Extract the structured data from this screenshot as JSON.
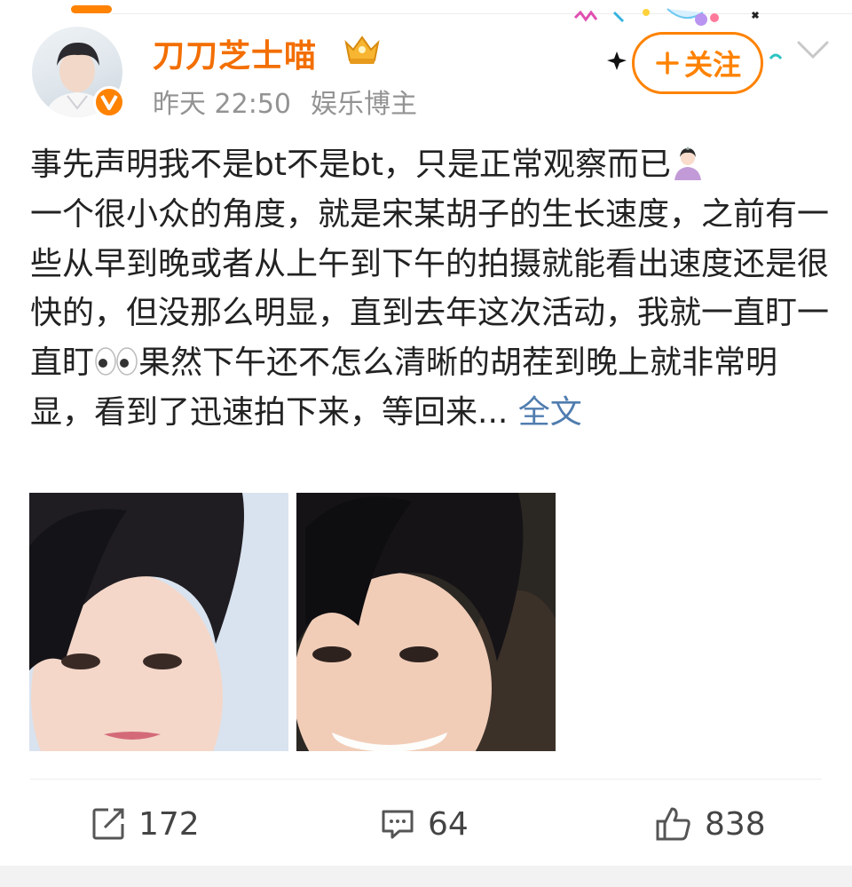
{
  "post": {
    "author": {
      "name": "刀刀芝士喵",
      "verified_icon": "v-badge-icon",
      "rank_icon": "crown-icon"
    },
    "time": "昨天 22:50",
    "tag": "娱乐博主",
    "follow_label": "关注",
    "text_before_woman_emoji": "事先声明我不是bt不是bt，只是正常观察而已",
    "text_middle": "\n一个很小众的角度，就是宋某胡子的生长速度，之前有一些从早到晚或者从上午到下午的拍摄就能看出速度还是很快的，但没那么明显，直到去年这次活动，我就一直盯一直盯",
    "text_after_eyes_emoji": "果然下午还不怎么清晰的胡茬到晚上就非常明显，看到了迅速拍下来，等回来... ",
    "more_label": "全文",
    "emojis": [
      "woman-raising-hand-emoji",
      "eyes-emoji"
    ]
  },
  "photos": [
    "photo-1",
    "photo-2"
  ],
  "actions": {
    "repost_count": "172",
    "comment_count": "64",
    "like_count": "838"
  },
  "colors": {
    "accent": "#ff8200",
    "username": "#f36e00",
    "link": "#507daf",
    "meta": "#939393"
  }
}
